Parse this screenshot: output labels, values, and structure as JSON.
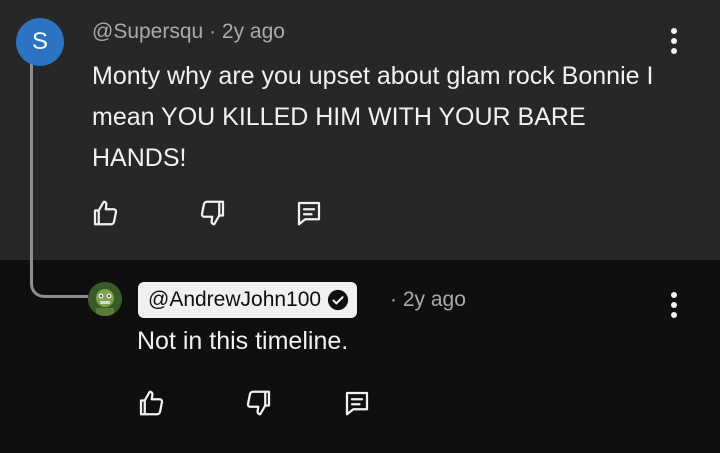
{
  "comments": [
    {
      "avatar_letter": "S",
      "avatar_color": "#2d73c4",
      "handle": "@Supersqu",
      "separator": "·",
      "time": "2y ago",
      "text": "Monty why are you upset about glam rock Bonnie I mean YOU KILLED HIM WITH YOUR BARE HANDS!",
      "actions": [
        "thumbs-up-icon",
        "thumbs-down-icon",
        "reply-icon"
      ]
    },
    {
      "avatar_icon": "character-avatar",
      "handle": "@AndrewJohn100",
      "verified": true,
      "separator": "·",
      "time": "2y ago",
      "text": "Not in this timeline.",
      "actions": [
        "thumbs-up-icon",
        "thumbs-down-icon",
        "reply-icon"
      ]
    }
  ],
  "colors": {
    "top_background": "#272727",
    "bottom_background": "#0f0f0f",
    "text": "#f1f1f1",
    "meta_text": "#aaaaaa"
  }
}
